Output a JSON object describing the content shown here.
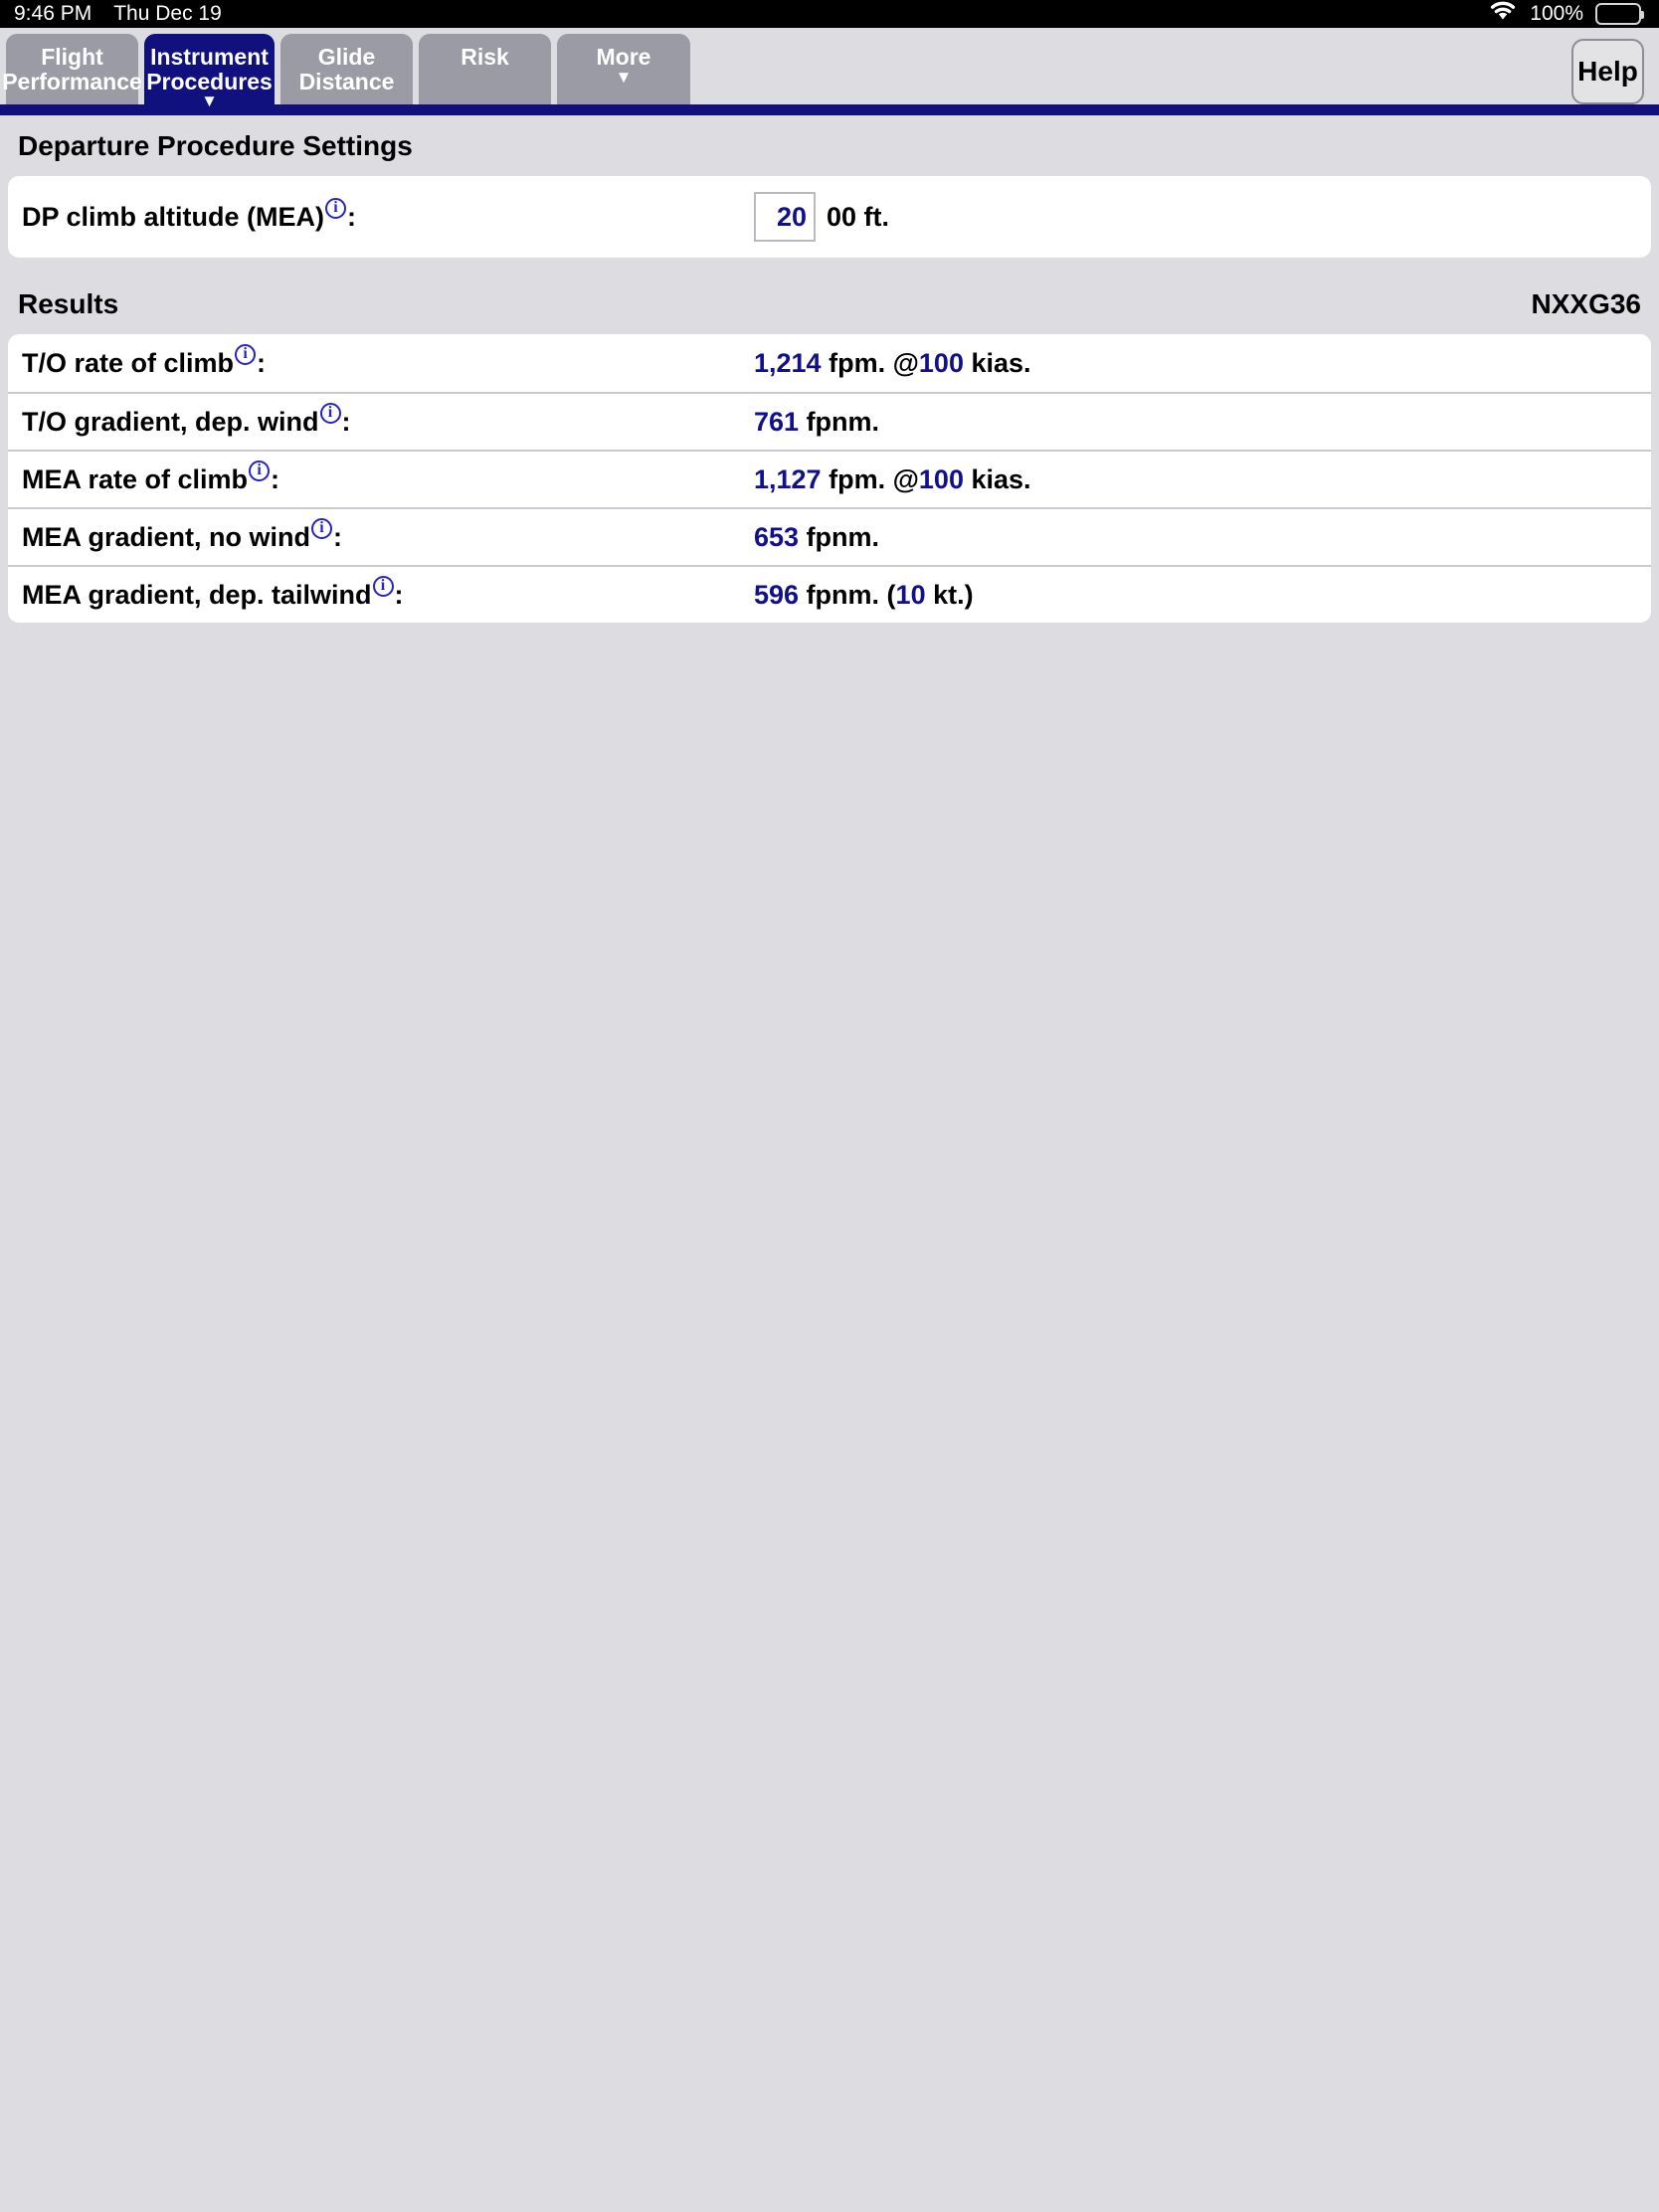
{
  "statusbar": {
    "time": "9:46 PM",
    "date": "Thu Dec 19",
    "battery_percent": "100%",
    "wifi_icon": "wifi-icon",
    "battery_icon": "battery-full-icon"
  },
  "tabbar": {
    "tabs": [
      {
        "label": "Flight\nPerformance",
        "active": false,
        "caret": ""
      },
      {
        "label": "Instrument\nProcedures",
        "active": true,
        "caret": "▼"
      },
      {
        "label": "Glide\nDistance",
        "active": false,
        "caret": ""
      },
      {
        "label": "Risk",
        "active": false,
        "caret": ""
      },
      {
        "label": "More",
        "active": false,
        "caret": "▼"
      }
    ],
    "help_label": "Help"
  },
  "settings": {
    "heading": "Departure Procedure Settings",
    "dp_climb_altitude": {
      "label": "DP climb altitude (MEA)",
      "info_icon": "info-icon",
      "colon": ":",
      "value": "20",
      "suffix": "00 ft."
    }
  },
  "results": {
    "heading": "Results",
    "aircraft_id": "NXXG36",
    "rows": [
      {
        "label": "T/O rate of climb",
        "info_icon": "info-icon",
        "colon": ":",
        "value": "1,214",
        "unit": " fpm. @",
        "value2": "100",
        "unit2": " kias."
      },
      {
        "label": "T/O gradient, dep. wind",
        "info_icon": "info-icon",
        "colon": ":",
        "value": "761",
        "unit": " fpnm.",
        "value2": "",
        "unit2": ""
      },
      {
        "label": "MEA rate of climb",
        "info_icon": "info-icon",
        "colon": ":",
        "value": "1,127",
        "unit": " fpm. @",
        "value2": "100",
        "unit2": " kias."
      },
      {
        "label": "MEA gradient, no wind",
        "info_icon": "info-icon",
        "colon": ":",
        "value": "653",
        "unit": " fpnm.",
        "value2": "",
        "unit2": ""
      },
      {
        "label": "MEA gradient, dep. tailwind",
        "info_icon": "info-icon",
        "colon": ":",
        "value": "596",
        "unit": " fpnm. (",
        "value2": "10",
        "unit2": " kt.)"
      }
    ]
  },
  "colors": {
    "accent_navy": "#10107e",
    "value_blue": "#10108e",
    "tab_gray": "#9b9ba6",
    "page_bg": "#dcdce1"
  }
}
